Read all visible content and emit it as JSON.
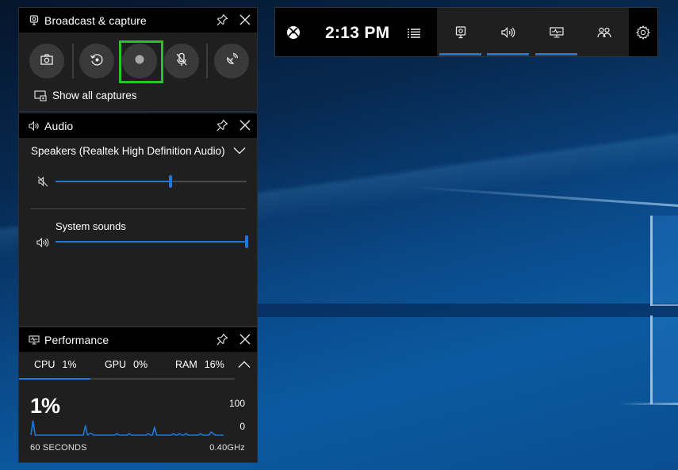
{
  "colors": {
    "accent": "#1e78d4",
    "record_highlight": "#28c328",
    "panel_bg": "#1f1f1f",
    "header_bg": "#000000"
  },
  "topbar": {
    "xbox_icon": "xbox-logo-icon",
    "time": "2:13 PM",
    "menu_icon": "list-menu-icon",
    "widgets": [
      {
        "name": "broadcast-capture",
        "icon": "capture-icon",
        "active": true
      },
      {
        "name": "audio",
        "icon": "speaker-icon",
        "active": true
      },
      {
        "name": "performance",
        "icon": "monitor-chart-icon",
        "active": true
      },
      {
        "name": "xbox-social",
        "icon": "people-icon",
        "active": false
      }
    ],
    "settings_icon": "gear-icon"
  },
  "broadcast": {
    "title": "Broadcast & capture",
    "buttons": [
      {
        "name": "screenshot",
        "icon": "camera-icon"
      },
      {
        "name": "record-last-30-seconds",
        "icon": "replay-icon"
      },
      {
        "name": "start-recording",
        "icon": "record-dot-icon",
        "highlighted": true
      },
      {
        "name": "microphone",
        "icon": "mic-off-icon"
      },
      {
        "name": "start-broadcast",
        "icon": "broadcast-icon"
      }
    ],
    "show_all_label": "Show all captures"
  },
  "audio": {
    "title": "Audio",
    "device": "Speakers (Realtek High Definition Audio)",
    "master_volume": 0.6,
    "master_muted": true,
    "apps": [
      {
        "label": "System sounds",
        "volume": 1.0
      }
    ]
  },
  "performance": {
    "title": "Performance",
    "tabs": [
      {
        "label": "CPU",
        "value": "1%",
        "active": true
      },
      {
        "label": "GPU",
        "value": "0%",
        "active": false
      },
      {
        "label": "RAM",
        "value": "16%",
        "active": false
      }
    ],
    "current": "1%",
    "axis_max": "100",
    "axis_min": "0",
    "duration_label": "60 SECONDS",
    "clock_label": "0.40GHz",
    "history_percent": [
      1,
      10,
      1,
      1,
      1,
      1,
      1,
      1,
      1,
      1,
      1,
      1,
      1,
      1,
      1,
      1,
      1,
      1,
      1,
      1,
      1,
      1,
      1,
      1,
      1,
      1,
      7,
      1,
      2,
      2,
      1,
      1,
      1,
      1,
      1,
      1,
      1,
      1,
      1,
      1,
      1,
      2,
      1,
      1,
      1,
      1,
      1,
      2,
      1,
      1,
      1,
      1,
      1,
      1,
      1,
      1,
      2,
      1,
      1,
      6,
      1,
      1,
      1,
      1,
      1,
      1,
      1,
      1,
      2,
      1,
      1,
      2,
      1,
      1,
      2,
      1,
      1,
      1,
      1,
      1,
      1,
      2,
      1,
      1,
      1,
      1,
      3,
      2,
      1,
      1,
      1,
      1,
      1
    ]
  }
}
